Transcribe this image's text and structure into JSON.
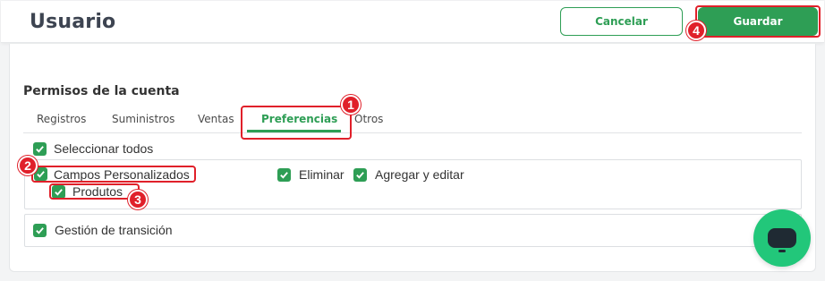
{
  "header": {
    "title": "Usuario",
    "cancel_label": "Cancelar",
    "save_label": "Guardar"
  },
  "permissions": {
    "section_title": "Permisos de la cuenta",
    "tabs": [
      {
        "label": "Registros",
        "active": false
      },
      {
        "label": "Suministros",
        "active": false
      },
      {
        "label": "Ventas",
        "active": false
      },
      {
        "label": "Preferencias",
        "active": true
      },
      {
        "label": "Otros",
        "active": false
      }
    ],
    "select_all": {
      "label": "Seleccionar todos",
      "checked": true
    },
    "custom_fields": {
      "label": "Campos Personalizados",
      "checked": true,
      "sub": {
        "label": "Produtos",
        "checked": true
      },
      "options": [
        {
          "label": "Eliminar",
          "checked": true
        },
        {
          "label": "Agregar y editar",
          "checked": true
        }
      ]
    },
    "transition": {
      "label": "Gestión de transición",
      "checked": true
    }
  },
  "annotations": [
    "1",
    "2",
    "3",
    "4"
  ],
  "colors": {
    "accent": "#2e9e55",
    "highlight": "#e0202a",
    "chat": "#22c77a"
  },
  "icons": {
    "checkbox": "check-icon",
    "chat": "chat-icon"
  }
}
